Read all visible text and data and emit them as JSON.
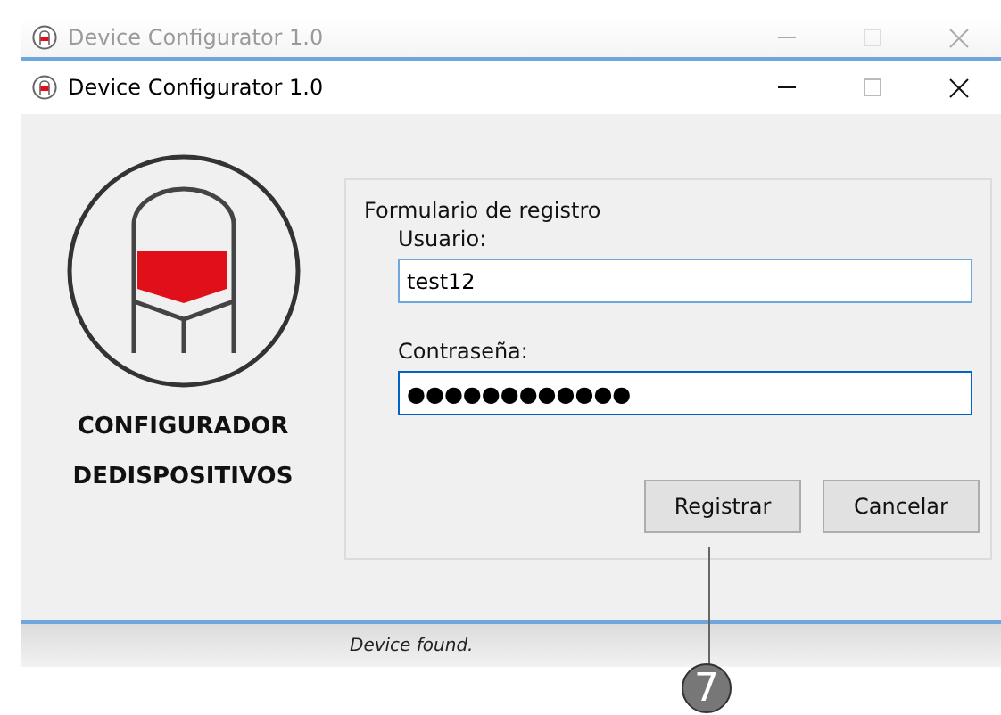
{
  "background_window": {
    "title": "Device Configurator 1.0"
  },
  "window": {
    "title": "Device Configurator 1.0"
  },
  "logo": {
    "lines": [
      "CONFIGURADOR",
      "DEDISPOSITIVOS"
    ]
  },
  "form": {
    "title": "Formulario de registro",
    "fields": [
      {
        "label": "Usuario:",
        "value": "test12",
        "focused": false
      },
      {
        "label": "Contraseña:",
        "value": "●●●●●●●●●●●●",
        "focused": true
      }
    ],
    "buttons": [
      "Registrar",
      "Cancelar"
    ]
  },
  "status_bar": {
    "text": "Device found."
  },
  "callout": {
    "number": "7"
  }
}
